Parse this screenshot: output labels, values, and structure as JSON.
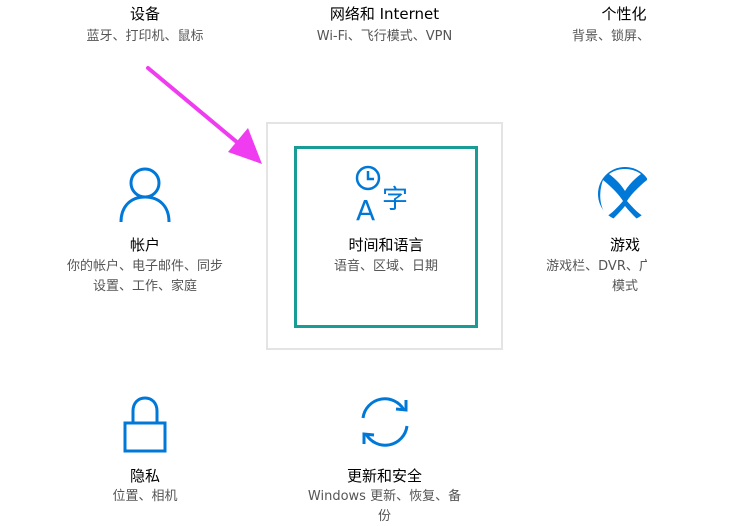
{
  "accent_color": "#0078d7",
  "focus_color": "#1a9c96",
  "arrow_color": "#f03cf0",
  "tiles": {
    "devices": {
      "title": "设备",
      "desc": [
        "蓝牙、打印机、鼠标"
      ]
    },
    "network": {
      "title": "网络和 Internet",
      "desc": [
        "Wi-Fi、飞行模式、VPN"
      ]
    },
    "personal": {
      "title": "个性化",
      "desc": [
        "背景、锁屏、颜色"
      ]
    },
    "accounts": {
      "title": "帐户",
      "desc": [
        "你的帐户、电子邮件、同步",
        "设置、工作、家庭"
      ],
      "icon": "person-icon"
    },
    "time": {
      "title": "时间和语言",
      "desc": [
        "语音、区域、日期"
      ],
      "icon": "time-language-icon"
    },
    "gaming": {
      "title": "游戏",
      "desc": [
        "游戏栏、DVR、广播、游戏",
        "模式"
      ],
      "icon": "xbox-icon"
    },
    "privacy": {
      "title": "隐私",
      "desc": [
        "位置、相机"
      ],
      "icon": "lock-icon"
    },
    "update": {
      "title": "更新和安全",
      "desc": [
        "Windows 更新、恢复、备",
        "份"
      ],
      "icon": "sync-icon"
    }
  }
}
